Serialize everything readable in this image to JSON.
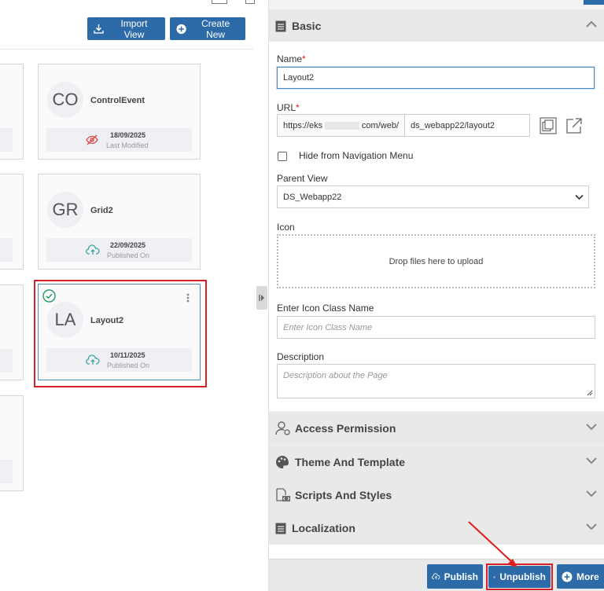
{
  "toolbar": {
    "import_label": "Import View",
    "create_label": "Create New"
  },
  "cards": [
    {
      "initials": "CO",
      "title": "ControlEvent",
      "date": "18/09/2025",
      "status": "Last Modified",
      "status_icon": "eye-off-icon"
    },
    {
      "initials": "GR",
      "title": "Grid2",
      "date": "22/09/2025",
      "status": "Published On",
      "status_icon": "cloud-upload-icon"
    },
    {
      "initials": "LA",
      "title": "Layout2",
      "date": "10/11/2025",
      "status": "Published On",
      "status_icon": "cloud-upload-icon",
      "selected": true
    }
  ],
  "sections": {
    "basic": "Basic",
    "access": "Access Permission",
    "theme": "Theme And Template",
    "scripts": "Scripts And Styles",
    "localization": "Localization"
  },
  "form": {
    "name_label": "Name",
    "name_value": "Layout2",
    "url_label": "URL",
    "url_prefix_start": "https://eks",
    "url_prefix_end": "com/web/",
    "url_value": "ds_webapp22/layout2",
    "hide_nav_label": "Hide from Navigation Menu",
    "parent_label": "Parent View",
    "parent_value": "DS_Webapp22",
    "icon_label": "Icon",
    "drop_text": "Drop files here to upload",
    "icon_class_label": "Enter Icon Class Name",
    "icon_class_placeholder": "Enter Icon Class Name",
    "description_label": "Description",
    "description_placeholder": "Description about the Page",
    "required_mark": "*"
  },
  "actions": {
    "publish": "Publish",
    "unpublish": "Unpublish",
    "more": "More"
  },
  "colors": {
    "primary": "#2c6aa8",
    "highlight": "#d61f26",
    "success": "#2e9e6b",
    "teal": "#3aa6a0"
  }
}
